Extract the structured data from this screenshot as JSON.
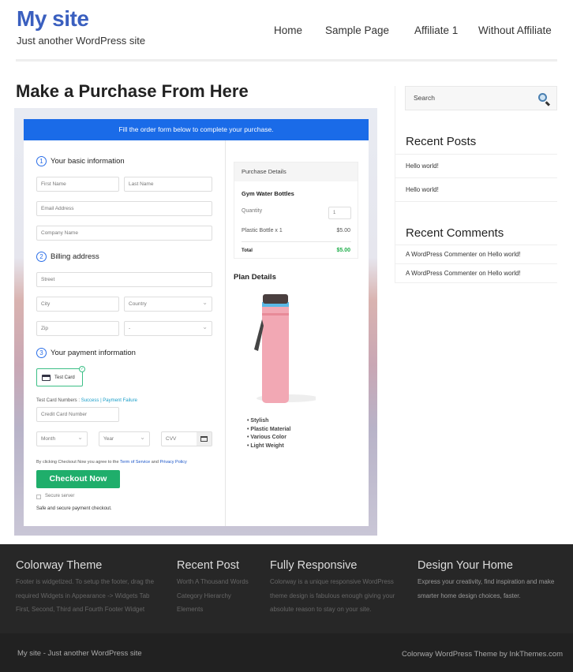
{
  "header": {
    "site_title": "My site",
    "tagline": "Just another WordPress site",
    "nav": [
      "Home",
      "Sample Page",
      "Affiliate 1",
      "Without Affiliate"
    ]
  },
  "page_title": "Make a Purchase From Here",
  "form": {
    "banner": "Fill the order form below to complete your purchase.",
    "step1": {
      "num": "1",
      "title": "Your basic information",
      "fields": [
        "First Name",
        "Last Name",
        "Email Address",
        "Company Name"
      ]
    },
    "step2": {
      "num": "2",
      "title": "Billing address",
      "fields": [
        "Street",
        "City",
        "Country",
        "Zip",
        "-"
      ]
    },
    "step3": {
      "num": "3",
      "title": "Your payment information",
      "card_option": "Test Card",
      "test_label": "Test Card Numbers :",
      "success": "Success",
      "sep": "|",
      "failure": "Payment Failure",
      "card_number": "Credit Card Number",
      "month": "Month",
      "year": "Year",
      "cvv": "CVV"
    },
    "agree_pre": "By clicking Checkout Now you agree to the",
    "tos": "Term of Service",
    "and": "and",
    "privacy": "Privacy Policy",
    "checkout": "Checkout Now",
    "secure": "Secure server",
    "safe": "Safe and secure payment checkout."
  },
  "purchase": {
    "header": "Purchase Details",
    "product": "Gym Water Bottles",
    "quantity_label": "Quantity",
    "quantity": "1",
    "line_item": "Plastic Bottle x 1",
    "line_price": "$5.00",
    "total_label": "Total",
    "total": "$5.00",
    "total_color": "#1fae4b"
  },
  "plan": {
    "title": "Plan Details",
    "features": [
      "Stylish",
      "Plastic Material",
      "Various Color",
      "Light Weight"
    ]
  },
  "sidebar": {
    "search_placeholder": "Search",
    "recent_posts_title": "Recent Posts",
    "recent_posts": [
      "Hello world!",
      "Hello world!"
    ],
    "recent_comments_title": "Recent Comments",
    "comments": [
      {
        "author": "A WordPress Commenter",
        "on": "on",
        "post": "Hello world!"
      },
      {
        "author": "A WordPress Commenter",
        "on": "on",
        "post": "Hello world!"
      }
    ]
  },
  "footer": {
    "cols": [
      {
        "title": "Colorway Theme",
        "lines": [
          "Footer is widgetized. To setup the footer, drag the",
          "required Widgets in Appearance -> Widgets Tab",
          "First, Second, Third and Fourth Footer Widget"
        ]
      },
      {
        "title": "Recent Post",
        "lines": [
          "Worth A Thousand Words",
          "Category Hierarchy",
          "Elements"
        ]
      },
      {
        "title": "Fully Responsive",
        "lines": [
          "Colorway is a unique responsive WordPress",
          "theme design is fabulous enough giving your",
          "absolute reason to stay on your site."
        ]
      },
      {
        "title": "Design Your Home",
        "lines": [
          "Express your creativity, find inspiration and make",
          "smarter home design choices, faster."
        ]
      }
    ],
    "bottom_left": "My site - Just another WordPress site",
    "bottom_right": "Colorway WordPress Theme by InkThemes.com"
  },
  "colors": {
    "brand": "#3a5fbf",
    "banner": "#1a6be8",
    "checkout": "#1fae6b"
  }
}
